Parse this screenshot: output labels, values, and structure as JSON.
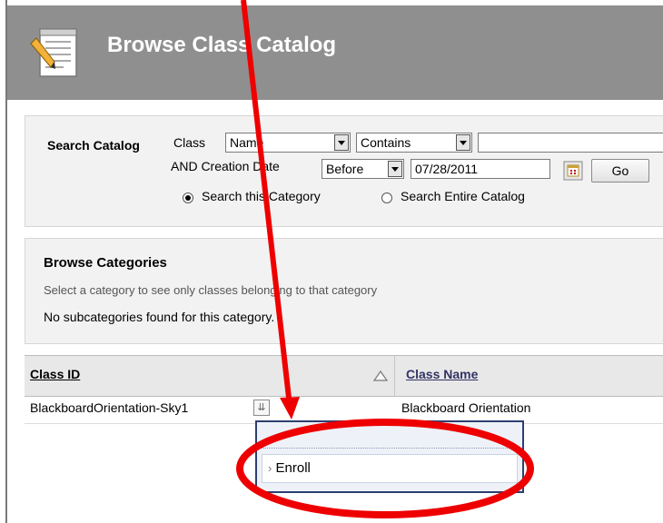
{
  "header": {
    "title": "Browse Class Catalog",
    "icon": "notepad-icon"
  },
  "search": {
    "label": "Search Catalog",
    "field_label": "Class",
    "field_value": "Name",
    "operator_value": "Contains",
    "text_value": "",
    "date_label": "AND Creation Date",
    "date_op_value": "Before",
    "date_value": "07/28/2011",
    "go_label": "Go",
    "radio_category": "Search this Category",
    "radio_catalog": "Search Entire Catalog"
  },
  "browse": {
    "title": "Browse Categories",
    "hint": "Select a category to see only classes belonging to that category",
    "empty": "No subcategories found for this category."
  },
  "table": {
    "columns": [
      "Class ID",
      "Class Name"
    ],
    "rows": [
      {
        "class_id": "BlackboardOrientation-Sky1",
        "class_name": "Blackboard Orientation"
      }
    ]
  },
  "context_menu": {
    "items": [
      "Enroll"
    ]
  },
  "annotation": {
    "arrow_color": "#ee0000",
    "circle_color": "#ee0000"
  }
}
